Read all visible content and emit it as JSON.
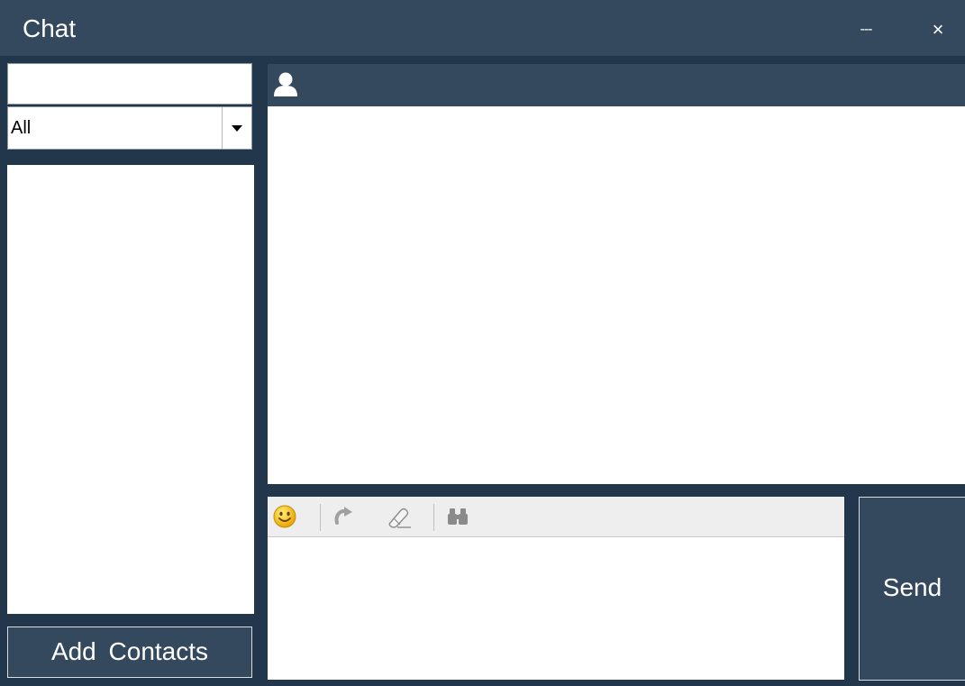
{
  "window": {
    "title": "Chat",
    "minimize_label": "---",
    "close_label": "×"
  },
  "sidebar": {
    "search": {
      "value": "",
      "placeholder": ""
    },
    "filter": {
      "selected": "All"
    },
    "add_contacts_label": "Add  Contacts"
  },
  "chat": {
    "header_icon": "user-icon",
    "toolbar": {
      "icons": [
        "smiley-icon",
        "redo-icon",
        "eraser-icon",
        "binoculars-icon"
      ]
    },
    "input": {
      "value": "",
      "placeholder": ""
    },
    "send_label": "Send"
  },
  "colors": {
    "titlebar": "#34495e",
    "frame": "#23374c",
    "accent_smiley": "#f5c518",
    "disabled_icon": "#a0a0a0"
  }
}
